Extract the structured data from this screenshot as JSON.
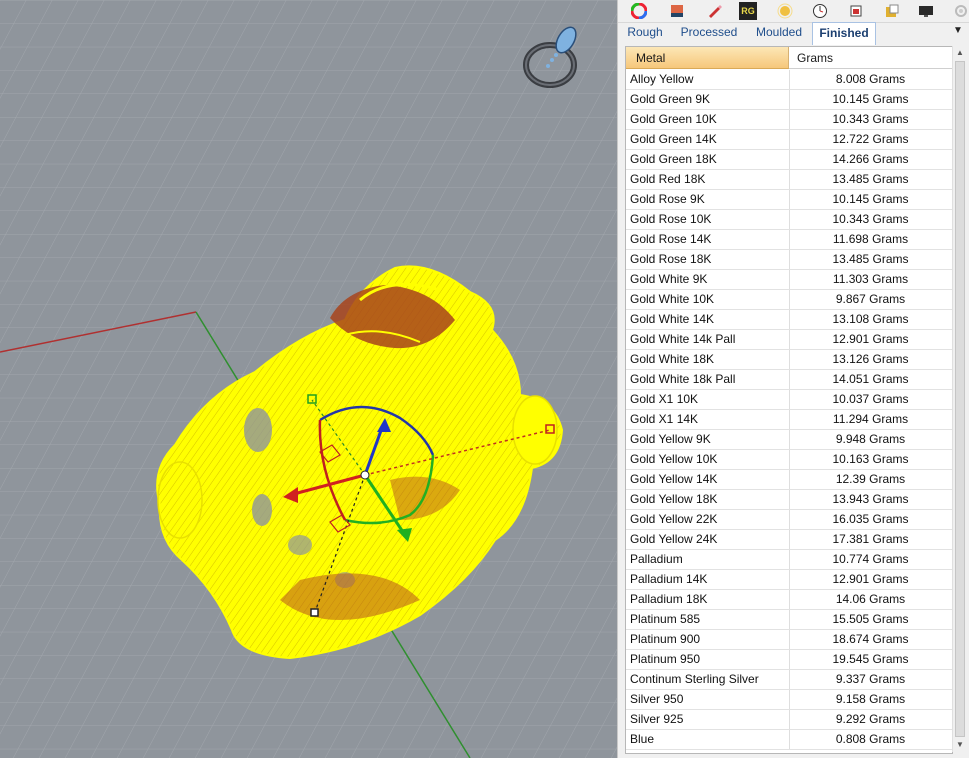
{
  "toolbar": {
    "icons": [
      "color-wheel-icon",
      "layer-icon",
      "pen-icon",
      "rg-icon",
      "sun-icon",
      "clock-icon",
      "render-icon",
      "material-icon",
      "display-icon",
      "settings-gear-icon"
    ],
    "rg_label": "RG"
  },
  "tabs": [
    {
      "label": "Rough",
      "active": false
    },
    {
      "label": "Processed",
      "active": false
    },
    {
      "label": "Moulded",
      "active": false
    },
    {
      "label": "Finished",
      "active": true
    }
  ],
  "table": {
    "headers": {
      "metal": "Metal",
      "grams": "Grams"
    },
    "rows": [
      {
        "metal": "Alloy Yellow",
        "grams": "8.008 Grams"
      },
      {
        "metal": "Gold Green 9K",
        "grams": "10.145 Grams"
      },
      {
        "metal": "Gold Green 10K",
        "grams": "10.343 Grams"
      },
      {
        "metal": "Gold Green 14K",
        "grams": "12.722 Grams"
      },
      {
        "metal": "Gold Green 18K",
        "grams": "14.266 Grams"
      },
      {
        "metal": "Gold Red 18K",
        "grams": "13.485 Grams"
      },
      {
        "metal": "Gold Rose 9K",
        "grams": "10.145 Grams"
      },
      {
        "metal": "Gold Rose 10K",
        "grams": "10.343 Grams"
      },
      {
        "metal": "Gold Rose 14K",
        "grams": "11.698 Grams"
      },
      {
        "metal": "Gold Rose 18K",
        "grams": "13.485 Grams"
      },
      {
        "metal": "Gold White 9K",
        "grams": "11.303 Grams"
      },
      {
        "metal": "Gold White 10K",
        "grams": "9.867 Grams"
      },
      {
        "metal": "Gold White 14K",
        "grams": "13.108 Grams"
      },
      {
        "metal": "Gold White 14k Pall",
        "grams": "12.901 Grams"
      },
      {
        "metal": "Gold White 18K",
        "grams": "13.126 Grams"
      },
      {
        "metal": "Gold White 18k Pall",
        "grams": "14.051 Grams"
      },
      {
        "metal": "Gold X1 10K",
        "grams": "10.037 Grams"
      },
      {
        "metal": "Gold X1 14K",
        "grams": "11.294 Grams"
      },
      {
        "metal": "Gold Yellow 9K",
        "grams": "9.948 Grams"
      },
      {
        "metal": "Gold Yellow 10K",
        "grams": "10.163 Grams"
      },
      {
        "metal": "Gold Yellow 14K",
        "grams": "12.39 Grams"
      },
      {
        "metal": "Gold Yellow 18K",
        "grams": "13.943 Grams"
      },
      {
        "metal": "Gold Yellow 22K",
        "grams": "16.035 Grams"
      },
      {
        "metal": "Gold Yellow 24K",
        "grams": "17.381 Grams"
      },
      {
        "metal": "Palladium",
        "grams": "10.774 Grams"
      },
      {
        "metal": "Palladium 14K",
        "grams": "12.901 Grams"
      },
      {
        "metal": "Palladium 18K",
        "grams": "14.06 Grams"
      },
      {
        "metal": "Platinum 585",
        "grams": "15.505 Grams"
      },
      {
        "metal": "Platinum 900",
        "grams": "18.674 Grams"
      },
      {
        "metal": "Platinum 950",
        "grams": "19.545 Grams"
      },
      {
        "metal": "Continum Sterling Silver",
        "grams": "9.337 Grams"
      },
      {
        "metal": "Silver 950",
        "grams": "9.158 Grams"
      },
      {
        "metal": "Silver 925",
        "grams": "9.292 Grams"
      },
      {
        "metal": "Blue",
        "grams": "0.808 Grams"
      }
    ]
  },
  "viewport": {
    "object": "ring-wireframe",
    "colors": {
      "background": "#8f959c",
      "grid": "#a4a9af",
      "wire": "#ffff00",
      "x_axis": "#b03030",
      "y_axis": "#2f8f2f"
    }
  }
}
